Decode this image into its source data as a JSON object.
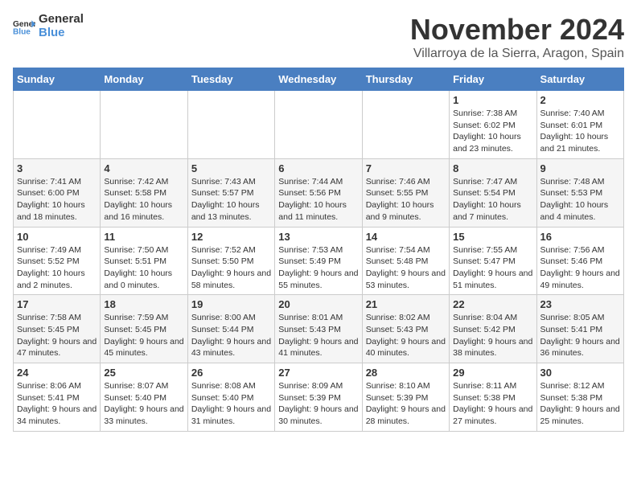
{
  "header": {
    "logo_general": "General",
    "logo_blue": "Blue",
    "month": "November 2024",
    "location": "Villarroya de la Sierra, Aragon, Spain"
  },
  "days_of_week": [
    "Sunday",
    "Monday",
    "Tuesday",
    "Wednesday",
    "Thursday",
    "Friday",
    "Saturday"
  ],
  "weeks": [
    [
      {
        "day": "",
        "info": ""
      },
      {
        "day": "",
        "info": ""
      },
      {
        "day": "",
        "info": ""
      },
      {
        "day": "",
        "info": ""
      },
      {
        "day": "",
        "info": ""
      },
      {
        "day": "1",
        "info": "Sunrise: 7:38 AM\nSunset: 6:02 PM\nDaylight: 10 hours and 23 minutes."
      },
      {
        "day": "2",
        "info": "Sunrise: 7:40 AM\nSunset: 6:01 PM\nDaylight: 10 hours and 21 minutes."
      }
    ],
    [
      {
        "day": "3",
        "info": "Sunrise: 7:41 AM\nSunset: 6:00 PM\nDaylight: 10 hours and 18 minutes."
      },
      {
        "day": "4",
        "info": "Sunrise: 7:42 AM\nSunset: 5:58 PM\nDaylight: 10 hours and 16 minutes."
      },
      {
        "day": "5",
        "info": "Sunrise: 7:43 AM\nSunset: 5:57 PM\nDaylight: 10 hours and 13 minutes."
      },
      {
        "day": "6",
        "info": "Sunrise: 7:44 AM\nSunset: 5:56 PM\nDaylight: 10 hours and 11 minutes."
      },
      {
        "day": "7",
        "info": "Sunrise: 7:46 AM\nSunset: 5:55 PM\nDaylight: 10 hours and 9 minutes."
      },
      {
        "day": "8",
        "info": "Sunrise: 7:47 AM\nSunset: 5:54 PM\nDaylight: 10 hours and 7 minutes."
      },
      {
        "day": "9",
        "info": "Sunrise: 7:48 AM\nSunset: 5:53 PM\nDaylight: 10 hours and 4 minutes."
      }
    ],
    [
      {
        "day": "10",
        "info": "Sunrise: 7:49 AM\nSunset: 5:52 PM\nDaylight: 10 hours and 2 minutes."
      },
      {
        "day": "11",
        "info": "Sunrise: 7:50 AM\nSunset: 5:51 PM\nDaylight: 10 hours and 0 minutes."
      },
      {
        "day": "12",
        "info": "Sunrise: 7:52 AM\nSunset: 5:50 PM\nDaylight: 9 hours and 58 minutes."
      },
      {
        "day": "13",
        "info": "Sunrise: 7:53 AM\nSunset: 5:49 PM\nDaylight: 9 hours and 55 minutes."
      },
      {
        "day": "14",
        "info": "Sunrise: 7:54 AM\nSunset: 5:48 PM\nDaylight: 9 hours and 53 minutes."
      },
      {
        "day": "15",
        "info": "Sunrise: 7:55 AM\nSunset: 5:47 PM\nDaylight: 9 hours and 51 minutes."
      },
      {
        "day": "16",
        "info": "Sunrise: 7:56 AM\nSunset: 5:46 PM\nDaylight: 9 hours and 49 minutes."
      }
    ],
    [
      {
        "day": "17",
        "info": "Sunrise: 7:58 AM\nSunset: 5:45 PM\nDaylight: 9 hours and 47 minutes."
      },
      {
        "day": "18",
        "info": "Sunrise: 7:59 AM\nSunset: 5:45 PM\nDaylight: 9 hours and 45 minutes."
      },
      {
        "day": "19",
        "info": "Sunrise: 8:00 AM\nSunset: 5:44 PM\nDaylight: 9 hours and 43 minutes."
      },
      {
        "day": "20",
        "info": "Sunrise: 8:01 AM\nSunset: 5:43 PM\nDaylight: 9 hours and 41 minutes."
      },
      {
        "day": "21",
        "info": "Sunrise: 8:02 AM\nSunset: 5:43 PM\nDaylight: 9 hours and 40 minutes."
      },
      {
        "day": "22",
        "info": "Sunrise: 8:04 AM\nSunset: 5:42 PM\nDaylight: 9 hours and 38 minutes."
      },
      {
        "day": "23",
        "info": "Sunrise: 8:05 AM\nSunset: 5:41 PM\nDaylight: 9 hours and 36 minutes."
      }
    ],
    [
      {
        "day": "24",
        "info": "Sunrise: 8:06 AM\nSunset: 5:41 PM\nDaylight: 9 hours and 34 minutes."
      },
      {
        "day": "25",
        "info": "Sunrise: 8:07 AM\nSunset: 5:40 PM\nDaylight: 9 hours and 33 minutes."
      },
      {
        "day": "26",
        "info": "Sunrise: 8:08 AM\nSunset: 5:40 PM\nDaylight: 9 hours and 31 minutes."
      },
      {
        "day": "27",
        "info": "Sunrise: 8:09 AM\nSunset: 5:39 PM\nDaylight: 9 hours and 30 minutes."
      },
      {
        "day": "28",
        "info": "Sunrise: 8:10 AM\nSunset: 5:39 PM\nDaylight: 9 hours and 28 minutes."
      },
      {
        "day": "29",
        "info": "Sunrise: 8:11 AM\nSunset: 5:38 PM\nDaylight: 9 hours and 27 minutes."
      },
      {
        "day": "30",
        "info": "Sunrise: 8:12 AM\nSunset: 5:38 PM\nDaylight: 9 hours and 25 minutes."
      }
    ]
  ]
}
